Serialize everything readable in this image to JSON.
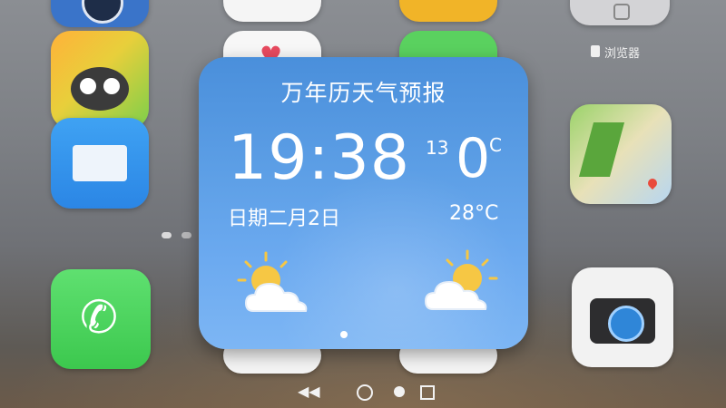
{
  "widget": {
    "title": "万年历天气预报",
    "time": "19:38",
    "date": "日期二月2日",
    "temp_small": "13",
    "temp_big": "0",
    "temp_big_unit": "C",
    "temp_high": "28°C",
    "left_weather_icon": "partly-cloudy-icon",
    "right_weather_icon": "partly-cloudy-icon"
  },
  "home": {
    "top_right_label": "浏览器",
    "apps": [
      "phone-icon",
      "mail-icon",
      "camera-icon",
      "maps-icon",
      "game-icon"
    ]
  },
  "colors": {
    "widget_top": "#4a8fdb",
    "widget_bottom": "#7db6f4",
    "phone_green": "#4cd964",
    "camera_bg": "#f2f2f2"
  }
}
